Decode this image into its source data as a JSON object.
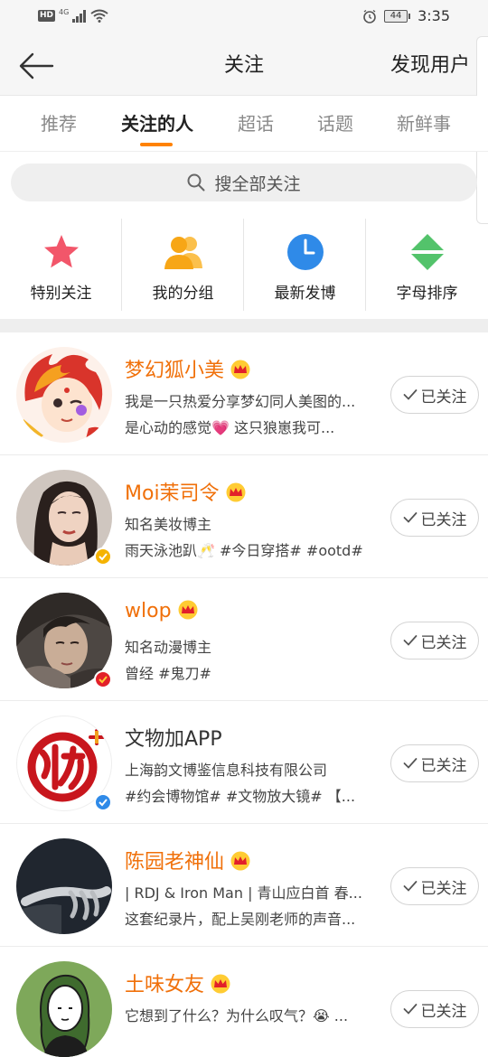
{
  "status_bar": {
    "hd": "HD",
    "network": "4G",
    "battery": "44",
    "time": "3:35"
  },
  "header": {
    "title": "关注",
    "action": "发现用户"
  },
  "tabs": [
    {
      "label": "推荐",
      "active": false
    },
    {
      "label": "关注的人",
      "active": true
    },
    {
      "label": "超话",
      "active": false
    },
    {
      "label": "话题",
      "active": false
    },
    {
      "label": "新鲜事",
      "active": false
    }
  ],
  "search": {
    "placeholder": "搜全部关注",
    "icon": "search-icon"
  },
  "categories": [
    {
      "label": "特别关注",
      "icon": "star-icon",
      "color": "#f2566a"
    },
    {
      "label": "我的分组",
      "icon": "group-icon",
      "color": "#f7a616"
    },
    {
      "label": "最新发博",
      "icon": "clock-icon",
      "color": "#2f8ae8"
    },
    {
      "label": "字母排序",
      "icon": "sort-arrows-icon",
      "color": "#53c36b"
    }
  ],
  "accent_color": "#ff8200",
  "name_color": "#f0700a",
  "users": [
    {
      "name": "梦幻狐小美",
      "vip": true,
      "line1": "我是一只热爱分享梦幻同人美图的...",
      "line2": "是心动的感觉💗 这只狼崽我可...",
      "follow_label": "已关注",
      "verify": "none"
    },
    {
      "name": "Moi茉司令",
      "vip": true,
      "line1": "知名美妆博主",
      "line2": "雨天泳池趴🥂 #今日穿搭# #ootd#",
      "follow_label": "已关注",
      "verify": "yellow"
    },
    {
      "name": "wlop",
      "vip": true,
      "line1": "知名动漫博主",
      "line2": "曾经 #鬼刀#",
      "follow_label": "已关注",
      "verify": "red"
    },
    {
      "name": "文物加APP",
      "vip": false,
      "line1": "上海韵文博鉴信息科技有限公司",
      "line2": "#约会博物馆# #文物放大镜# 【...",
      "follow_label": "已关注",
      "verify": "blue"
    },
    {
      "name": "陈园老神仙",
      "vip": true,
      "line1": "| RDJ & Iron Man | 青山应白首 春...",
      "line2": "这套纪录片，配上吴刚老师的声音...",
      "follow_label": "已关注",
      "verify": "none"
    },
    {
      "name": "土味女友",
      "vip": true,
      "line1": "它想到了什么？为什么叹气？😭 ...",
      "line2": "",
      "follow_label": "已关注",
      "verify": "none"
    }
  ]
}
